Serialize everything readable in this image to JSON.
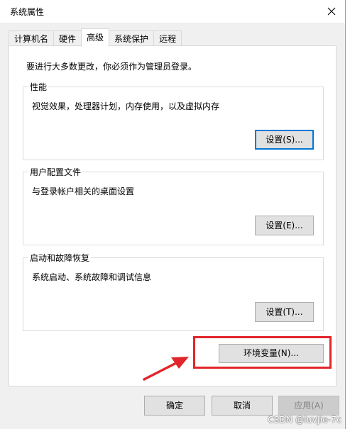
{
  "window": {
    "title": "系统属性"
  },
  "tabs": [
    {
      "label": "计算机名"
    },
    {
      "label": "硬件"
    },
    {
      "label": "高级"
    },
    {
      "label": "系统保护"
    },
    {
      "label": "远程"
    }
  ],
  "advanced": {
    "notice": "要进行大多数更改，你必须作为管理员登录。",
    "performance": {
      "title": "性能",
      "description": "视觉效果，处理器计划，内存使用，以及虚拟内存",
      "button": "设置(S)..."
    },
    "user_profiles": {
      "title": "用户配置文件",
      "description": "与登录帐户相关的桌面设置",
      "button": "设置(E)..."
    },
    "startup_recovery": {
      "title": "启动和故障恢复",
      "description": "系统启动、系统故障和调试信息",
      "button": "设置(T)..."
    },
    "env_button": "环境变量(N)..."
  },
  "footer": {
    "ok": "确定",
    "cancel": "取消",
    "apply": "应用(A)"
  },
  "watermark": "CSDN @luvJie-7c",
  "colors": {
    "annotation_red": "#e2252a",
    "focus_blue": "#0078d7"
  }
}
